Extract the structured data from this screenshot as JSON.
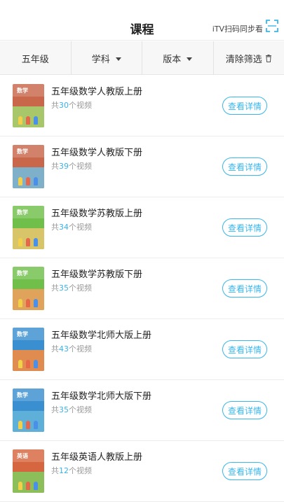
{
  "header": {
    "title": "课程",
    "itv_label": "iTV扫码同步看"
  },
  "filter": {
    "grade": "五年级",
    "subject": "学科",
    "edition": "版本",
    "clear": "清除筛选"
  },
  "list": {
    "count_prefix": "共",
    "count_suffix": "个视频",
    "button_label": "查看详情",
    "items": [
      {
        "name": "五年级数学人教版上册",
        "count": "30",
        "cover_label": "数学",
        "cover_color": "#c9674a",
        "scene_color": "#a8c76b"
      },
      {
        "name": "五年级数学人教版下册",
        "count": "39",
        "cover_label": "数学",
        "cover_color": "#c9674a",
        "scene_color": "#7fb0c9"
      },
      {
        "name": "五年级数学苏教版上册",
        "count": "34",
        "cover_label": "数学",
        "cover_color": "#6fbf4a",
        "scene_color": "#d8c56a"
      },
      {
        "name": "五年级数学苏教版下册",
        "count": "35",
        "cover_label": "数学",
        "cover_color": "#6fbf4a",
        "scene_color": "#e0a35c"
      },
      {
        "name": "五年级数学北师大版上册",
        "count": "43",
        "cover_label": "数学",
        "cover_color": "#3a8fd0",
        "scene_color": "#e08b4f"
      },
      {
        "name": "五年级数学北师大版下册",
        "count": "35",
        "cover_label": "数学",
        "cover_color": "#3a8fd0",
        "scene_color": "#5fb0d8"
      },
      {
        "name": "五年级英语人教版上册",
        "count": "12",
        "cover_label": "英语",
        "cover_color": "#d6663f",
        "scene_color": "#8cbf5a"
      }
    ]
  },
  "colors": {
    "accent": "#39b6ea",
    "count_number": "#3bb3e8"
  }
}
